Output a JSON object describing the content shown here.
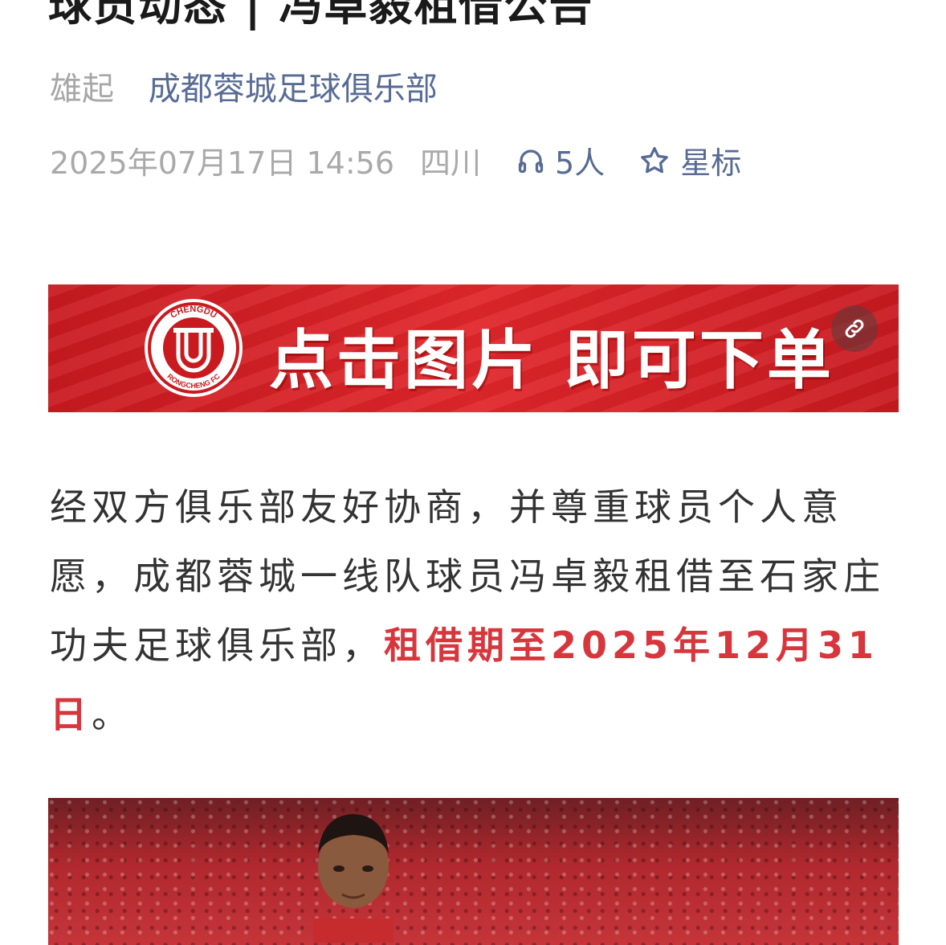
{
  "article": {
    "title": "球员动态 | 冯卓毅租借公告",
    "author": "雄起",
    "account": "成都蓉城足球俱乐部",
    "date": "2025年07月17日 14:56",
    "location": "四川",
    "listen_count": "5人",
    "star_label": "星标"
  },
  "banner": {
    "text": "点击图片 即可下单",
    "badge_top_text": "CHENGDU",
    "badge_bottom_text": "RONGCHENG FC",
    "link_icon": "link-icon"
  },
  "body": {
    "paragraph_start": "经双方俱乐部友好协商，并尊重球员个人意愿，成都蓉城一线队球员冯卓毅租借至石家庄功夫足球俱乐部，",
    "paragraph_highlight": "租借期至2025年12月31日",
    "paragraph_end": "。"
  },
  "colors": {
    "link_blue": "#576b95",
    "highlight_red": "#d6363c",
    "banner_red": "#e0262b"
  }
}
